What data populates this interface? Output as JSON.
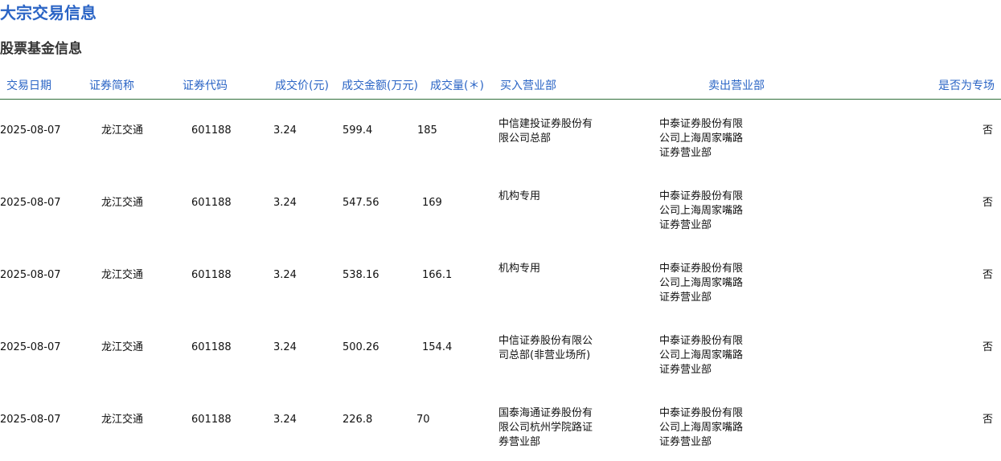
{
  "page": {
    "title": "大宗交易信息",
    "section_title": "股票基金信息"
  },
  "table": {
    "headers": {
      "date": "交易日期",
      "name": "证券简称",
      "code": "证券代码",
      "price": "成交价(元)",
      "amount": "成交金额(万元)",
      "volume": "成交量(＊)",
      "buyer": "买入营业部",
      "seller": "卖出营业部",
      "dedicated": "是否为专场"
    },
    "rows": [
      {
        "date": "2025-08-07",
        "name": "龙江交通",
        "code": "601188",
        "price": "3.24",
        "amount": "599.4",
        "volume": "185",
        "buyer": "中信建投证券股份有限公司总部",
        "seller": "中泰证券股份有限公司上海周家嘴路证券营业部",
        "dedicated": "否"
      },
      {
        "date": "2025-08-07",
        "name": "龙江交通",
        "code": "601188",
        "price": "3.24",
        "amount": "547.56",
        "volume": "169",
        "buyer": "机构专用",
        "seller": "中泰证券股份有限公司上海周家嘴路证券营业部",
        "dedicated": "否"
      },
      {
        "date": "2025-08-07",
        "name": "龙江交通",
        "code": "601188",
        "price": "3.24",
        "amount": "538.16",
        "volume": "166.1",
        "buyer": "机构专用",
        "seller": "中泰证券股份有限公司上海周家嘴路证券营业部",
        "dedicated": "否"
      },
      {
        "date": "2025-08-07",
        "name": "龙江交通",
        "code": "601188",
        "price": "3.24",
        "amount": "500.26",
        "volume": "154.4",
        "buyer": "中信证券股份有限公司总部(非营业场所)",
        "seller": "中泰证券股份有限公司上海周家嘴路证券营业部",
        "dedicated": "否"
      },
      {
        "date": "2025-08-07",
        "name": "龙江交通",
        "code": "601188",
        "price": "3.24",
        "amount": "226.8",
        "volume": "70",
        "buyer": "国泰海通证券股份有限公司杭州学院路证券营业部",
        "seller": "中泰证券股份有限公司上海周家嘴路证券营业部",
        "dedicated": "否"
      }
    ]
  },
  "colors": {
    "title": "#2a64c5",
    "header_text": "#2a64c5",
    "header_border": "#2f6f3a",
    "body_text": "#111111"
  }
}
